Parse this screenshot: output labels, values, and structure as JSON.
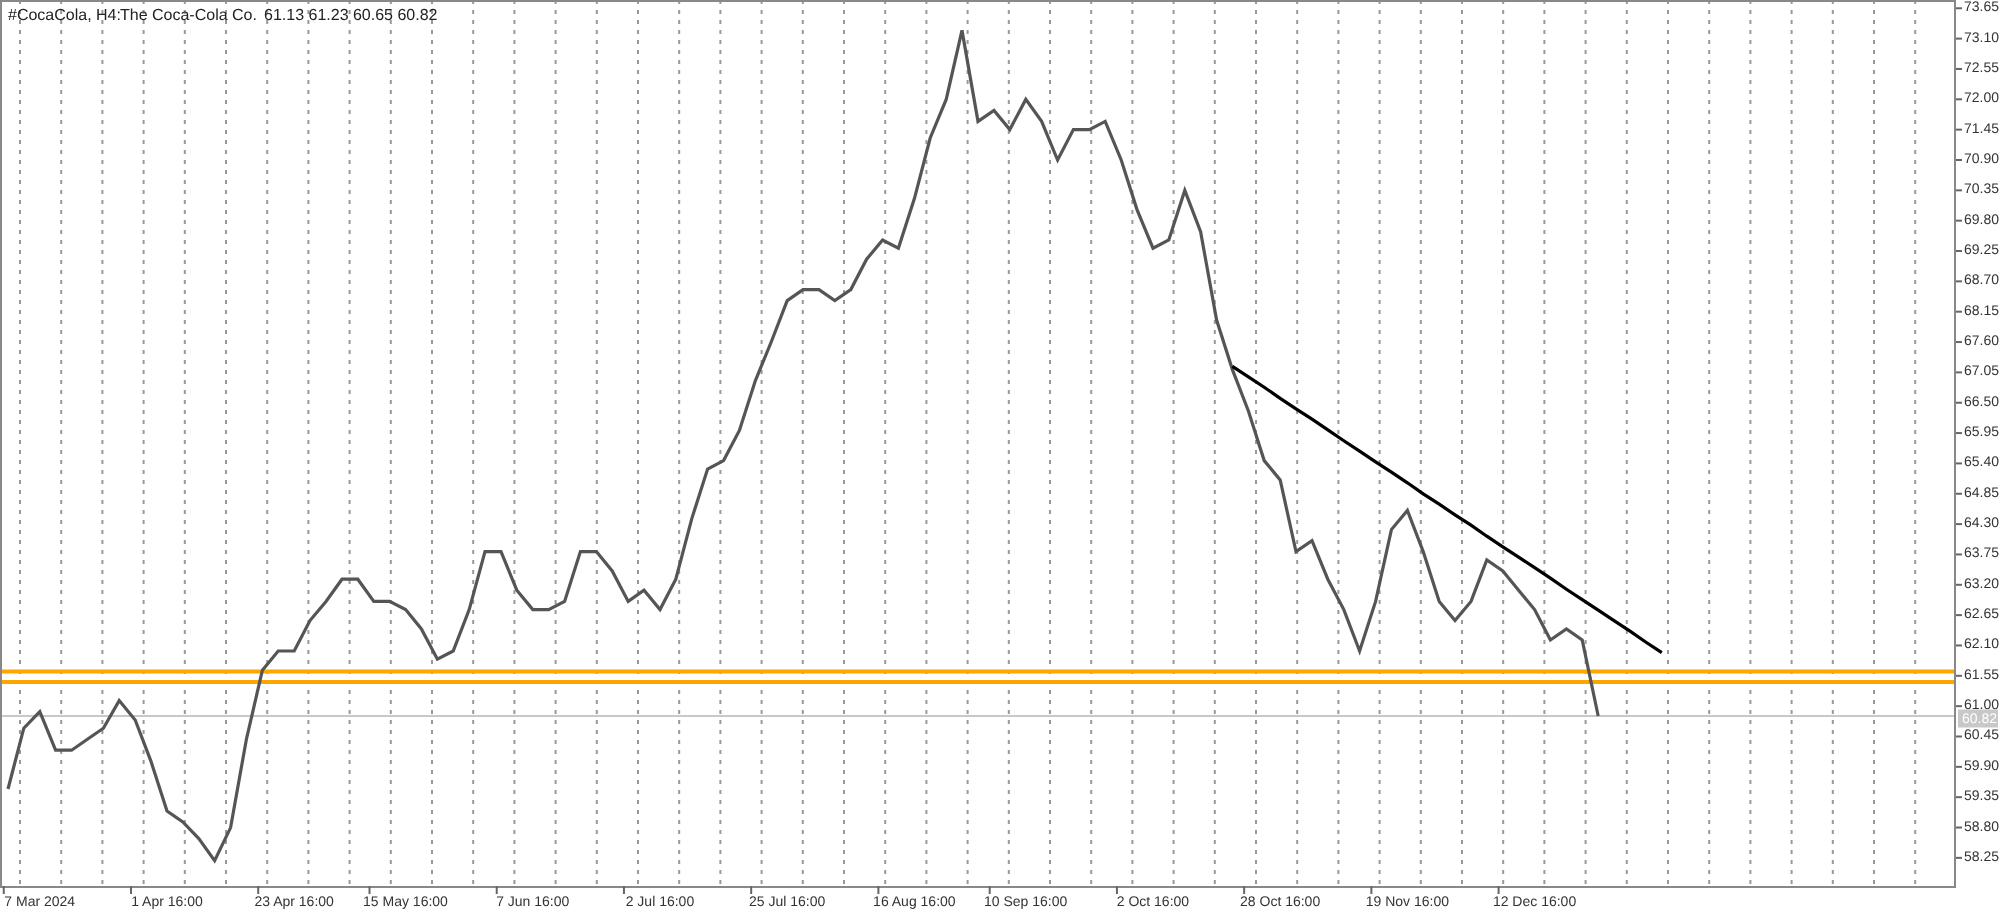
{
  "header": {
    "symbol": "#CocaCola, H4:",
    "name": "The Coca-Cola Co.",
    "quotes": "61.13 61.23 60.65 60.82"
  },
  "chart_data": {
    "type": "line",
    "grid": true,
    "ylim": [
      57.74,
      73.8
    ],
    "categories": [
      null,
      null,
      "7 Mar 2024",
      null,
      null,
      null,
      null,
      null,
      null,
      null,
      "1 Apr 16:00",
      null,
      null,
      null,
      null,
      null,
      null,
      null,
      "23 Apr 16:00",
      null,
      null,
      null,
      null,
      null,
      null,
      "15 May 16:00",
      null,
      null,
      null,
      null,
      null,
      null,
      null,
      "7 Jun 16:00",
      null,
      null,
      null,
      null,
      null,
      null,
      null,
      "2 Jul 16:00",
      null,
      null,
      null,
      null,
      null,
      null,
      null,
      "25 Jul 16:00",
      null,
      null,
      null,
      null,
      null,
      null,
      null,
      "16 Aug 16:00",
      null,
      null,
      null,
      null,
      null,
      null,
      "10 Sep 16:00",
      null,
      null,
      null,
      null,
      null,
      null,
      null,
      "2 Oct 16:00",
      null,
      null,
      null,
      null,
      null,
      null,
      null,
      "28 Oct 16:00",
      null,
      null,
      null,
      null,
      null,
      null,
      null,
      "19 Nov 16:00",
      null,
      null,
      null,
      null,
      null,
      null,
      null,
      "12 Dec 16:00",
      null,
      null,
      null,
      null,
      null,
      null,
      null,
      null,
      null,
      null,
      null,
      null,
      null,
      null,
      null,
      null,
      null,
      null,
      null,
      null,
      null,
      null,
      null,
      null,
      null,
      null
    ],
    "series": [
      {
        "color": "#555555",
        "values": [
          59.5,
          60.6,
          60.9,
          60.2,
          60.2,
          60.4,
          60.6,
          61.1,
          60.75,
          60.0,
          59.1,
          58.9,
          58.6,
          58.2,
          58.8,
          60.4,
          61.65,
          62.0,
          62.0,
          62.55,
          62.9,
          63.3,
          63.3,
          62.9,
          62.9,
          62.75,
          62.4,
          61.85,
          62.0,
          62.75,
          63.8,
          63.8,
          63.1,
          62.75,
          62.75,
          62.9,
          63.8,
          63.8,
          63.45,
          62.9,
          63.1,
          62.75,
          63.3,
          64.4,
          65.3,
          65.45,
          66.0,
          66.9,
          67.6,
          68.35,
          68.55,
          68.55,
          68.35,
          68.55,
          69.1,
          69.45,
          69.3,
          70.2,
          71.3,
          72.0,
          73.25,
          71.6,
          71.8,
          71.45,
          72.0,
          71.6,
          70.9,
          71.45,
          71.45,
          71.6,
          70.9,
          70.0,
          69.3,
          69.45,
          70.35,
          69.6,
          68.0,
          67.1,
          66.35,
          65.45,
          65.1,
          63.8,
          64.0,
          63.3,
          62.75,
          62.0,
          62.9,
          64.2,
          64.55,
          63.8,
          62.9,
          62.55,
          62.9,
          63.65,
          63.45,
          63.1,
          62.75,
          62.2,
          62.4,
          62.2,
          60.82,
          null,
          null,
          null,
          null,
          null,
          null,
          null,
          null,
          null,
          null,
          null,
          null,
          null,
          null,
          null,
          null,
          null,
          null,
          null,
          null,
          null,
          null
        ]
      },
      {
        "color": "#000000",
        "values": [
          null,
          null,
          null,
          null,
          null,
          null,
          null,
          null,
          null,
          null,
          null,
          null,
          null,
          null,
          null,
          null,
          null,
          null,
          null,
          null,
          null,
          null,
          null,
          null,
          null,
          null,
          null,
          null,
          null,
          null,
          null,
          null,
          null,
          null,
          null,
          null,
          null,
          null,
          null,
          null,
          null,
          null,
          null,
          null,
          null,
          null,
          null,
          null,
          null,
          null,
          null,
          null,
          null,
          null,
          null,
          null,
          null,
          null,
          null,
          null,
          null,
          null,
          null,
          null,
          null,
          null,
          null,
          null,
          null,
          null,
          null,
          null,
          null,
          null,
          null,
          null,
          null,
          67.16,
          66.97,
          66.78,
          66.58,
          66.39,
          66.2,
          66.01,
          65.81,
          65.62,
          65.43,
          65.24,
          65.05,
          64.85,
          64.66,
          64.47,
          64.28,
          64.08,
          63.89,
          63.7,
          63.51,
          63.32,
          63.12,
          62.93,
          62.74,
          62.55,
          62.36,
          62.16,
          61.97,
          null,
          null,
          null,
          null,
          null,
          null,
          null,
          null,
          null,
          null,
          null,
          null,
          null,
          null,
          null,
          null,
          null,
          null
        ]
      }
    ],
    "yticks": [
      {
        "value": 73.65,
        "label": "73.65"
      },
      {
        "value": 73.1,
        "label": "73.10"
      },
      {
        "value": 72.55,
        "label": "72.55"
      },
      {
        "value": 72.0,
        "label": "72.00"
      },
      {
        "value": 71.45,
        "label": "71.45"
      },
      {
        "value": 70.9,
        "label": "70.90"
      },
      {
        "value": 70.35,
        "label": "70.35"
      },
      {
        "value": 69.8,
        "label": "69.80"
      },
      {
        "value": 69.25,
        "label": "69.25"
      },
      {
        "value": 68.7,
        "label": "68.70"
      },
      {
        "value": 68.15,
        "label": "68.15"
      },
      {
        "value": 67.6,
        "label": "67.60"
      },
      {
        "value": 67.05,
        "label": "67.05"
      },
      {
        "value": 66.5,
        "label": "66.50"
      },
      {
        "value": 65.95,
        "label": "65.95"
      },
      {
        "value": 65.4,
        "label": "65.40"
      },
      {
        "value": 64.85,
        "label": "64.85"
      },
      {
        "value": 64.3,
        "label": "64.30"
      },
      {
        "value": 63.75,
        "label": "63.75"
      },
      {
        "value": 63.2,
        "label": "63.20"
      },
      {
        "value": 62.65,
        "label": "62.65"
      },
      {
        "value": 62.1,
        "label": "62.10"
      },
      {
        "value": 61.55,
        "label": "61.55"
      },
      {
        "value": 61.0,
        "label": "61.00"
      },
      {
        "value": 60.45,
        "label": "60.45"
      },
      {
        "value": 59.9,
        "label": "59.90"
      },
      {
        "value": 59.35,
        "label": "59.35"
      },
      {
        "value": 58.8,
        "label": "58.80"
      },
      {
        "value": 58.25,
        "label": "58.25"
      }
    ],
    "ref_lines": [
      {
        "axis": "y",
        "value": 61.63,
        "color": "#ffa500"
      },
      {
        "axis": "y",
        "value": 61.44,
        "color": "#ffa500"
      },
      {
        "axis": "y",
        "value": 60.82,
        "color": "#c8c8c8",
        "label": "60.82"
      }
    ]
  }
}
